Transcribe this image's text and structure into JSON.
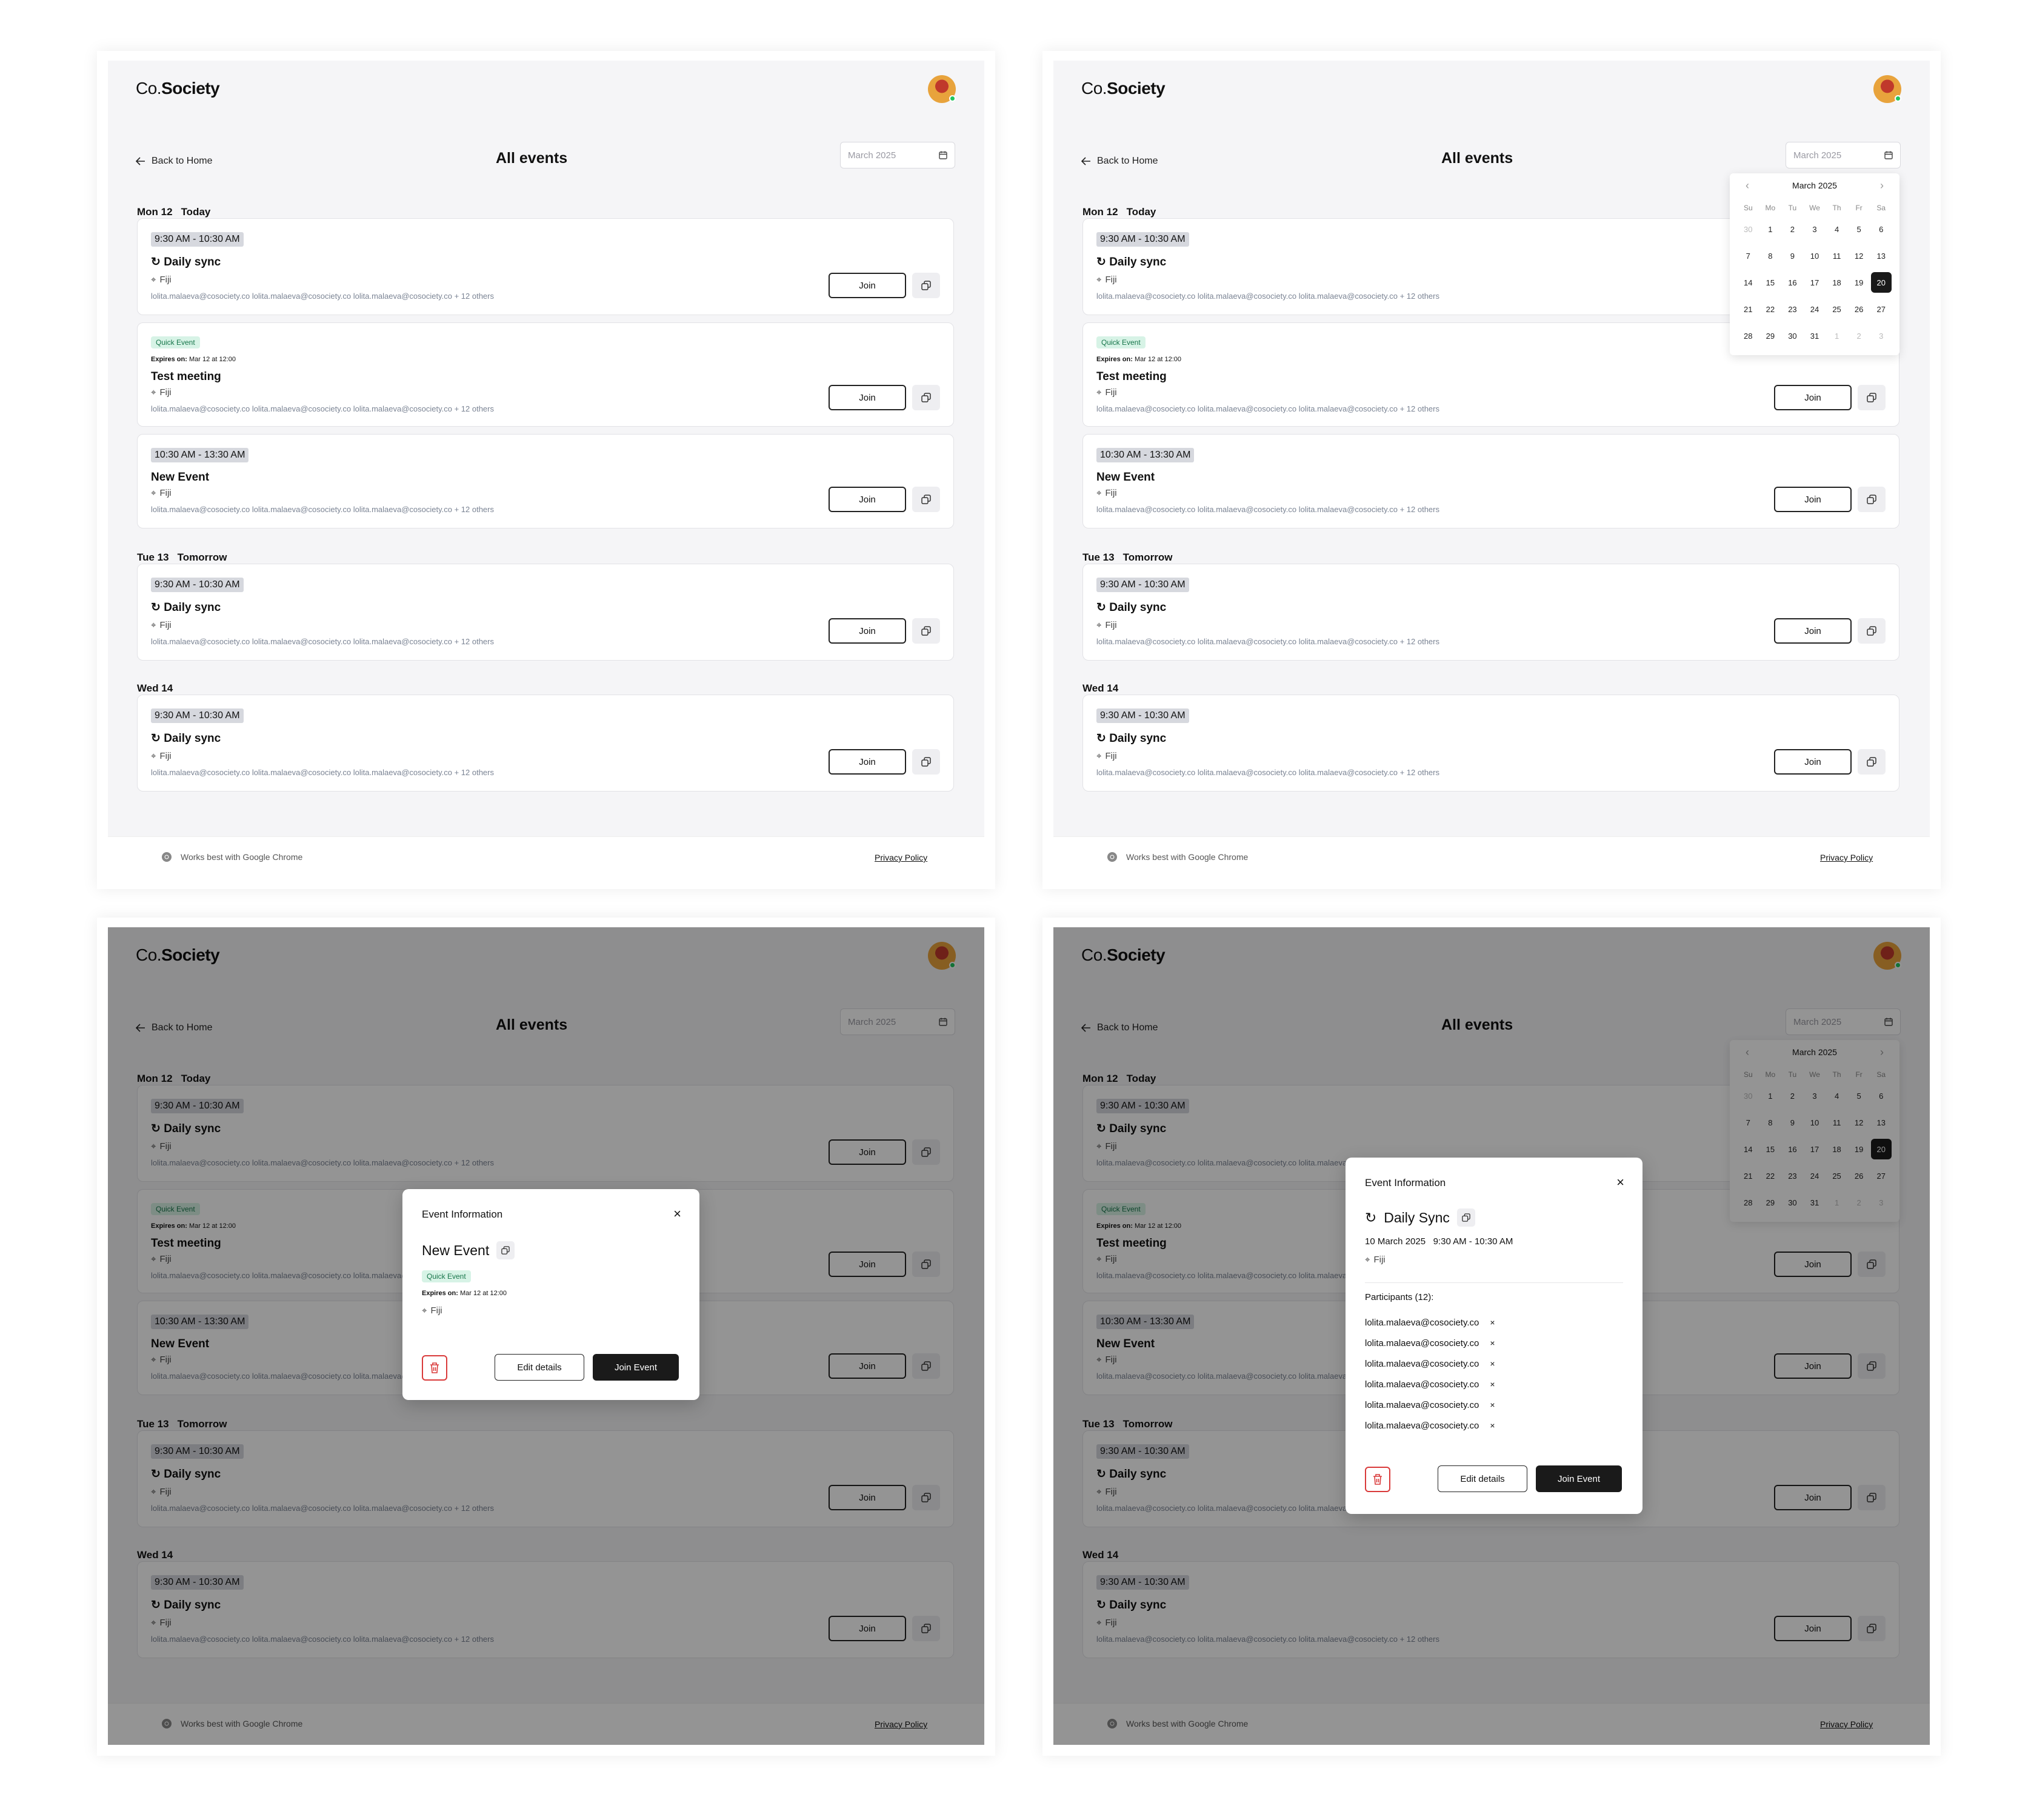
{
  "app": {
    "logo_prefix": "Co.",
    "logo_name": "Society"
  },
  "header": {
    "back_label": "Back to Home",
    "page_title": "All events",
    "month_value": "March 2025"
  },
  "days": [
    {
      "label": "Mon 12",
      "rel": "Today"
    },
    {
      "label": "Tue 13",
      "rel": "Tomorrow"
    },
    {
      "label": "Wed 14",
      "rel": ""
    }
  ],
  "events": [
    {
      "time": "9:30 AM - 10:30 AM",
      "name": "Daily sync",
      "location": "Fiji",
      "emails": "lolita.malaeva@cosociety.co lolita.malaeva@cosociety.co lolita.malaeva@cosociety.co + 12 others",
      "join": "Join"
    },
    {
      "badge": "Quick Event",
      "expires_label": "Expires on:",
      "expires_value": "Mar 12 at 12:00",
      "name": "Test meeting",
      "location": "Fiji",
      "emails": "lolita.malaeva@cosociety.co lolita.malaeva@cosociety.co lolita.malaeva@cosociety.co + 12 others",
      "join": "Join"
    },
    {
      "time": "10:30 AM - 13:30 AM",
      "name": "New Event",
      "location": "Fiji",
      "emails": "lolita.malaeva@cosociety.co lolita.malaeva@cosociety.co lolita.malaeva@cosociety.co + 12 others",
      "join": "Join"
    },
    {
      "time": "9:30 AM - 10:30 AM",
      "name": "Daily sync",
      "location": "Fiji",
      "emails": "lolita.malaeva@cosociety.co lolita.malaeva@cosociety.co lolita.malaeva@cosociety.co + 12 others",
      "join": "Join"
    },
    {
      "time": "9:30 AM - 10:30 AM",
      "name": "Daily sync",
      "location": "Fiji",
      "emails": "lolita.malaeva@cosociety.co lolita.malaeva@cosociety.co lolita.malaeva@cosociety.co + 12 others",
      "join": "Join"
    }
  ],
  "footer": {
    "chrome_note": "Works best with Google Chrome",
    "privacy": "Privacy Policy"
  },
  "calendar": {
    "month_label": "March 2025",
    "weekdays": [
      "Su",
      "Mo",
      "Tu",
      "We",
      "Th",
      "Fr",
      "Sa"
    ],
    "days": [
      "30",
      "1",
      "2",
      "3",
      "4",
      "5",
      "6",
      "7",
      "8",
      "9",
      "10",
      "11",
      "12",
      "13",
      "14",
      "15",
      "16",
      "17",
      "18",
      "19",
      "20",
      "21",
      "22",
      "23",
      "24",
      "25",
      "26",
      "27",
      "28",
      "29",
      "30",
      "31",
      "1",
      "2",
      "3"
    ],
    "selected": "20"
  },
  "modal_new": {
    "title": "Event Information",
    "close": "×",
    "name": "New Event",
    "badge": "Quick Event",
    "expires_label": "Expires on:",
    "expires_value": "Mar 12 at 12:00",
    "location": "Fiji",
    "edit": "Edit details",
    "join": "Join Event"
  },
  "modal_sync": {
    "title": "Event Information",
    "close": "×",
    "name": "Daily Sync",
    "date": "10 March 2025",
    "time": "9:30 AM - 10:30 AM",
    "location": "Fiji",
    "participants_label": "Participants (12):",
    "participants": [
      "lolita.malaeva@cosociety.co",
      "lolita.malaeva@cosociety.co",
      "lolita.malaeva@cosociety.co",
      "lolita.malaeva@cosociety.co",
      "lolita.malaeva@cosociety.co",
      "lolita.malaeva@cosociety.co"
    ],
    "remove": "×",
    "edit": "Edit details",
    "join": "Join Event"
  },
  "colors": {
    "accent": "#1a1a1a",
    "quick_badge": "#d7f3e6",
    "danger": "#d93a3a"
  }
}
